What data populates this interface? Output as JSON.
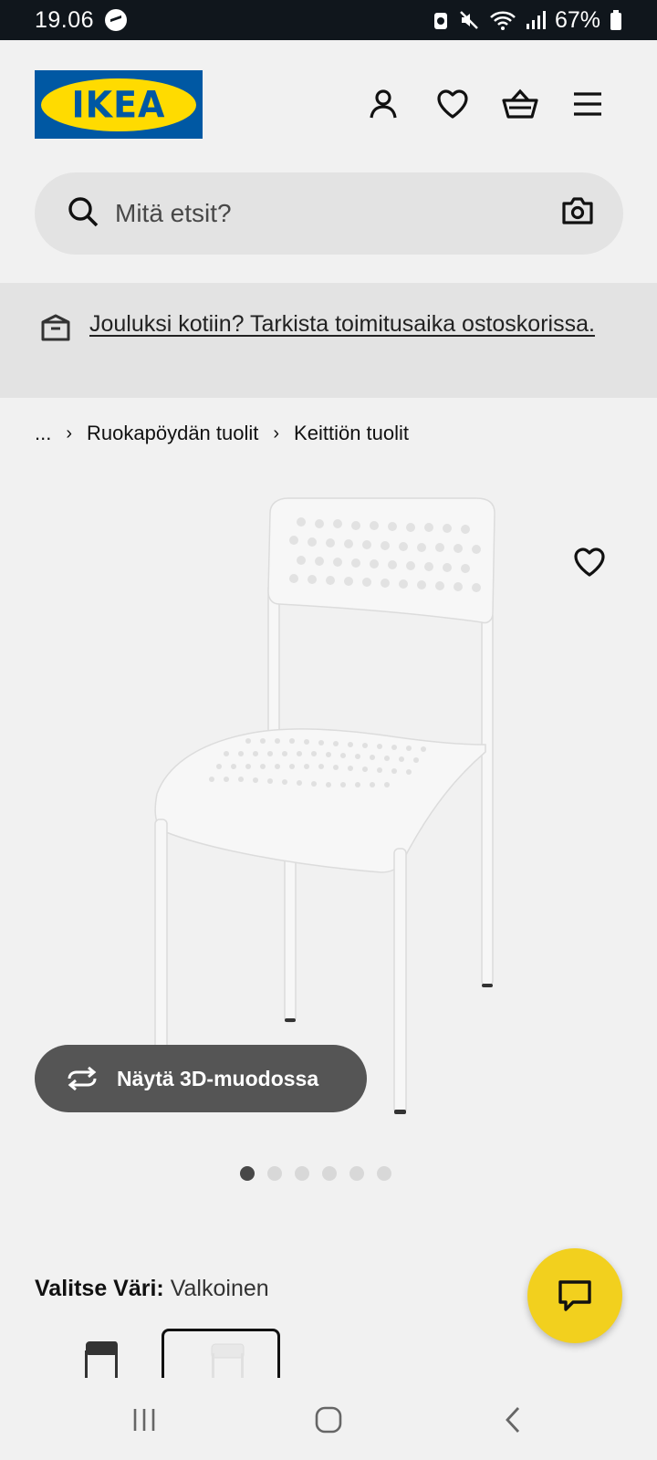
{
  "status_bar": {
    "time": "19.06",
    "battery": "67%"
  },
  "header": {
    "logo_text": "IKEA",
    "icons": [
      "account-icon",
      "wishlist-heart-icon",
      "shopping-basket-icon",
      "menu-icon"
    ]
  },
  "search": {
    "placeholder": "Mitä etsit?"
  },
  "banner": {
    "message": "Jouluksi kotiin? Tarkista toimitusaika ostoskorissa."
  },
  "breadcrumb": {
    "ellipsis": "...",
    "items": [
      "Ruokapöydän tuolit",
      "Keittiön tuolit"
    ]
  },
  "product": {
    "view_3d_label": "Näytä 3D-muodossa",
    "image_count": 6,
    "active_image": 1,
    "color_label": "Valitse Väri:",
    "color_value": "Valkoinen",
    "swatches": [
      "black",
      "white"
    ],
    "selected_swatch": "white"
  },
  "colors": {
    "brand_blue": "#0058a3",
    "brand_yellow": "#ffdb00",
    "chat_yellow": "#f2d01e",
    "button_dark": "#555555"
  }
}
